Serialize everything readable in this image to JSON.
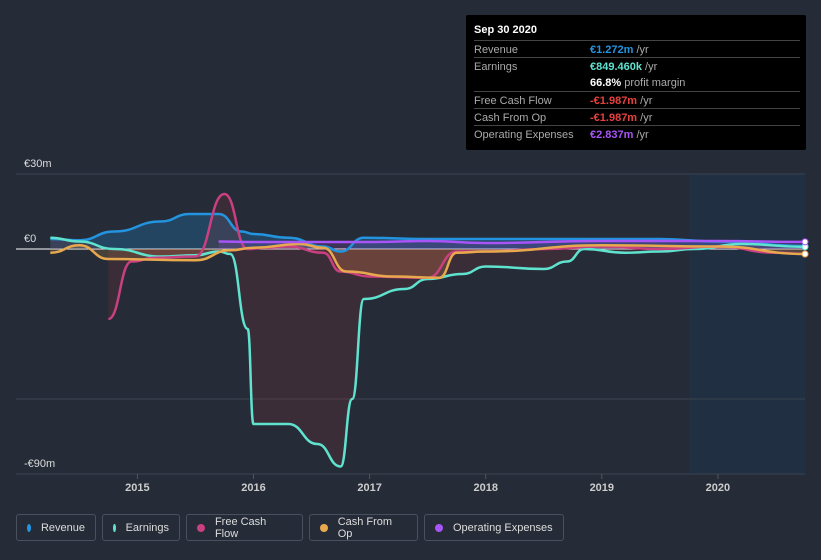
{
  "tooltip": {
    "date": "Sep 30 2020",
    "rows": [
      {
        "label": "Revenue",
        "value": "€1.272m",
        "unit": " /yr",
        "color": "#2394df"
      },
      {
        "label": "Earnings",
        "value": "€849.460k",
        "unit": " /yr",
        "color": "#5fe3cf"
      },
      {
        "label": "",
        "value": "66.8%",
        "unit": " profit margin",
        "color": "#ffffff"
      },
      {
        "label": "Free Cash Flow",
        "value": "-€1.987m",
        "unit": " /yr",
        "color": "#e64141"
      },
      {
        "label": "Cash From Op",
        "value": "-€1.987m",
        "unit": " /yr",
        "color": "#e64141"
      },
      {
        "label": "Operating Expenses",
        "value": "€2.837m",
        "unit": " /yr",
        "color": "#a855f7"
      }
    ]
  },
  "chart_data": {
    "type": "line",
    "ylim": [
      -90,
      30
    ],
    "xlim": [
      2014.23,
      2020.75
    ],
    "y_tick_labels": [
      "€30m",
      "€0",
      "-€90m"
    ],
    "y_ticks": [
      30,
      0,
      -90
    ],
    "x_tick_labels": [
      "2015",
      "2016",
      "2017",
      "2018",
      "2019",
      "2020"
    ],
    "x_ticks": [
      2015,
      2016,
      2017,
      2018,
      2019,
      2020
    ],
    "forecast_region_start": 2019.75,
    "series": [
      {
        "name": "Revenue",
        "color": "#2394df",
        "points": [
          [
            2014.25,
            4
          ],
          [
            2014.5,
            3.5
          ],
          [
            2014.8,
            7
          ],
          [
            2015.2,
            11
          ],
          [
            2015.45,
            14
          ],
          [
            2015.7,
            14
          ],
          [
            2015.9,
            7
          ],
          [
            2016,
            6
          ],
          [
            2016.3,
            4.5
          ],
          [
            2016.6,
            1
          ],
          [
            2016.75,
            -1
          ],
          [
            2016.95,
            4.5
          ],
          [
            2017.5,
            4
          ],
          [
            2018,
            4
          ],
          [
            2019,
            4
          ],
          [
            2019.5,
            4
          ],
          [
            2020,
            3
          ],
          [
            2020.75,
            1.2
          ]
        ]
      },
      {
        "name": "Earnings",
        "color": "#5fe3cf",
        "points": [
          [
            2014.25,
            4.5
          ],
          [
            2014.5,
            3
          ],
          [
            2014.8,
            0
          ],
          [
            2015.2,
            -3
          ],
          [
            2015.5,
            -2.5
          ],
          [
            2015.7,
            -1
          ],
          [
            2015.8,
            -2
          ],
          [
            2015.95,
            -32
          ],
          [
            2016,
            -70
          ],
          [
            2016.3,
            -70
          ],
          [
            2016.55,
            -78
          ],
          [
            2016.75,
            -87
          ],
          [
            2016.85,
            -60
          ],
          [
            2016.95,
            -20
          ],
          [
            2017.3,
            -16
          ],
          [
            2017.5,
            -12
          ],
          [
            2017.8,
            -10
          ],
          [
            2018,
            -7
          ],
          [
            2018.5,
            -8
          ],
          [
            2018.7,
            -5
          ],
          [
            2018.85,
            0
          ],
          [
            2019.2,
            -1.5
          ],
          [
            2019.5,
            -1
          ],
          [
            2019.8,
            0
          ],
          [
            2020.2,
            2
          ],
          [
            2020.75,
            0.85
          ]
        ]
      },
      {
        "name": "Free Cash Flow",
        "color": "#c94080",
        "points": [
          [
            2014.75,
            -28
          ],
          [
            2014.95,
            -5
          ],
          [
            2015.15,
            -3.5
          ],
          [
            2015.5,
            -3
          ],
          [
            2015.75,
            22
          ],
          [
            2015.95,
            0
          ],
          [
            2016.1,
            0.5
          ],
          [
            2016.3,
            1
          ],
          [
            2016.6,
            -1.5
          ],
          [
            2016.75,
            -9
          ],
          [
            2017,
            -11
          ],
          [
            2017.5,
            -11.5
          ],
          [
            2017.75,
            -1
          ],
          [
            2018,
            -1
          ],
          [
            2018.5,
            0
          ],
          [
            2019,
            1
          ],
          [
            2019.5,
            0
          ],
          [
            2020,
            1
          ],
          [
            2020.5,
            -1.5
          ],
          [
            2020.75,
            -1.99
          ]
        ]
      },
      {
        "name": "Cash From Op",
        "color": "#e8a94e",
        "points": [
          [
            2014.25,
            -1.5
          ],
          [
            2014.5,
            1.5
          ],
          [
            2014.75,
            -4
          ],
          [
            2015.5,
            -4.5
          ],
          [
            2015.8,
            -0.5
          ],
          [
            2016,
            0.5
          ],
          [
            2016.4,
            2
          ],
          [
            2016.6,
            0.5
          ],
          [
            2016.8,
            -9
          ],
          [
            2017.2,
            -11
          ],
          [
            2017.6,
            -11.5
          ],
          [
            2017.75,
            -1.5
          ],
          [
            2018,
            -1
          ],
          [
            2019,
            1.5
          ],
          [
            2020,
            1
          ],
          [
            2020.75,
            -1.99
          ]
        ]
      },
      {
        "name": "Operating Expenses",
        "color": "#a855f7",
        "points": [
          [
            2015.7,
            3
          ],
          [
            2016,
            2.8
          ],
          [
            2017,
            2.8
          ],
          [
            2017.5,
            3.2
          ],
          [
            2018,
            2.4
          ],
          [
            2019,
            3.2
          ],
          [
            2020,
            3.2
          ],
          [
            2020.75,
            2.84
          ]
        ]
      }
    ]
  },
  "legend": [
    "Revenue",
    "Earnings",
    "Free Cash Flow",
    "Cash From Op",
    "Operating Expenses"
  ]
}
